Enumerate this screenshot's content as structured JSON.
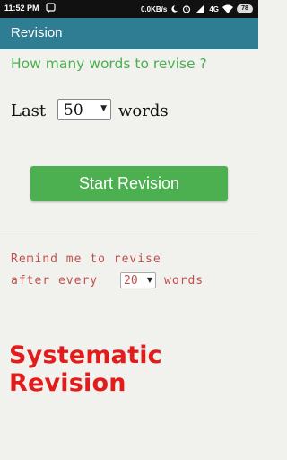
{
  "status_bar": {
    "time": "11:52 PM",
    "network_speed": "0.0KB/s",
    "network_type": "4G",
    "battery": "78"
  },
  "app_bar": {
    "title": "Revision"
  },
  "main": {
    "question": "How many words to revise ?",
    "last_label": "Last",
    "words_count_value": "50",
    "words_label": "words",
    "start_button_label": "Start Revision"
  },
  "reminder": {
    "line1": "Remind me to revise",
    "line2_prefix": "after every",
    "interval_value": "20",
    "line2_suffix": "words"
  },
  "slogan": "Systematic Revision",
  "colors": {
    "app_bar": "#2e7d92",
    "accent_green": "#4caf50",
    "reminder_text": "#c0504d",
    "slogan_red": "#e21b1b"
  }
}
